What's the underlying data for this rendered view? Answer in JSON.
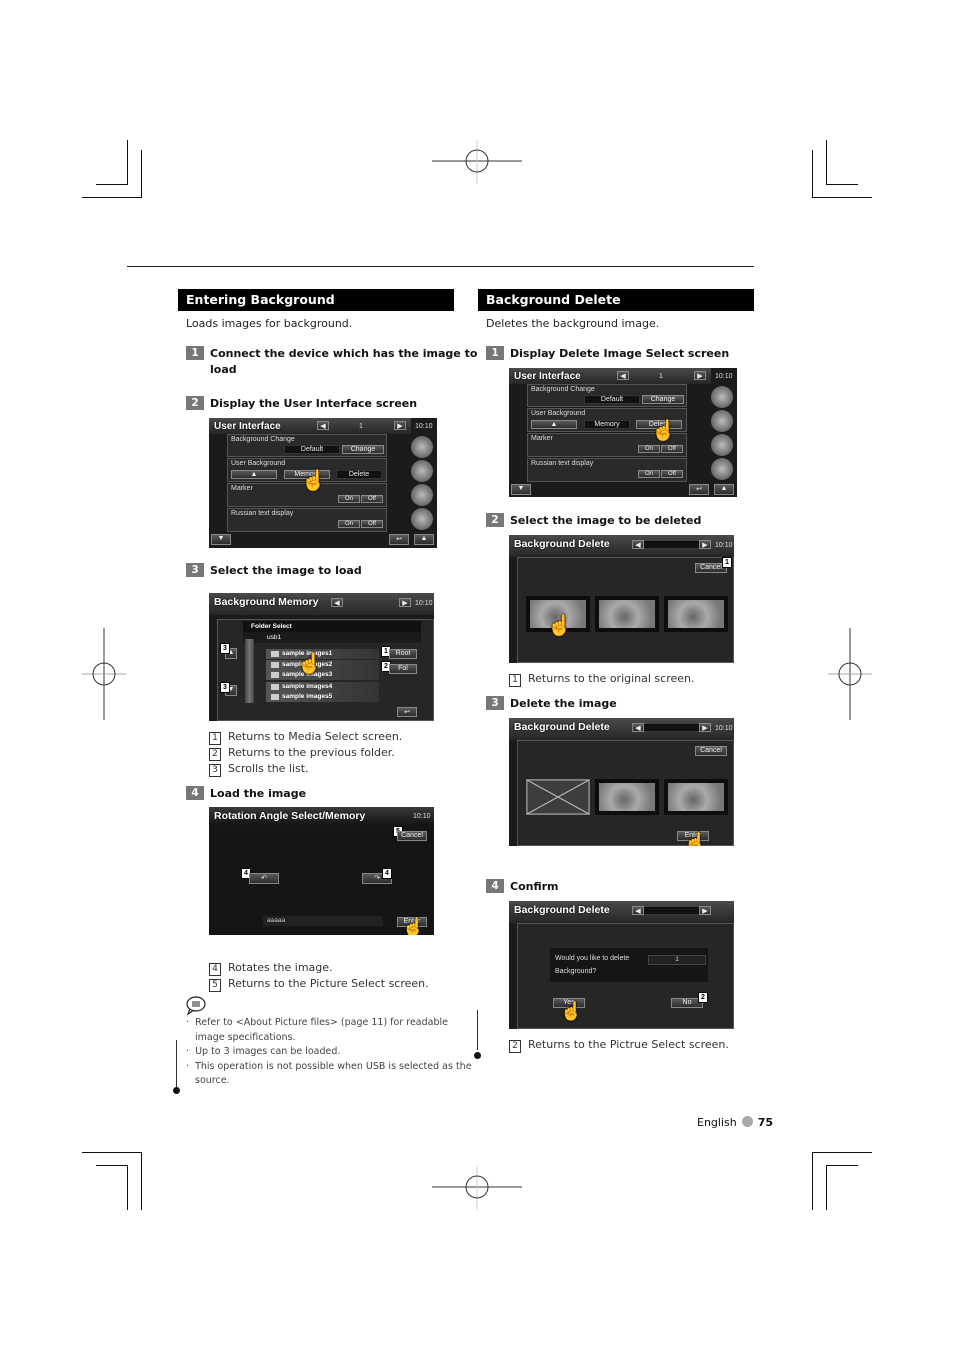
{
  "left": {
    "header": "Entering Background",
    "intro": "Loads images for background.",
    "steps": [
      {
        "num": "1",
        "text": "Connect the device which has the image to",
        "text2": "load"
      },
      {
        "num": "2",
        "text": "Display the User Interface screen"
      },
      {
        "num": "3",
        "text": "Select the image to load"
      },
      {
        "num": "4",
        "text": "Load the image"
      }
    ],
    "ui_screen": {
      "title": "User Interface",
      "page": "1",
      "clock": "10:10",
      "rows": [
        {
          "label": "Background Change",
          "buttons": [
            "Default",
            "Change"
          ]
        },
        {
          "label": "User Background",
          "buttons": [
            "▲",
            "Memory",
            "Delete"
          ]
        },
        {
          "label": "Marker",
          "buttons": [
            "On",
            "Off"
          ]
        },
        {
          "label": "Russian text display",
          "buttons": [
            "On",
            "Off"
          ]
        }
      ]
    },
    "memory_screen": {
      "title": "Background Memory",
      "clock": "10:10",
      "folder_select": "Folder Select",
      "path": "usb1",
      "folders": [
        "sample images1",
        "sample images2",
        "sample images3",
        "sample images4",
        "sample images5"
      ],
      "root": "Root",
      "fol": "Fol",
      "callouts": [
        "1",
        "2",
        "3",
        "3"
      ]
    },
    "memory_notes": [
      {
        "n": "1",
        "text": "Returns to Media Select screen."
      },
      {
        "n": "2",
        "text": "Returns to the previous folder."
      },
      {
        "n": "3",
        "text": "Scrolls the list."
      }
    ],
    "rotation_screen": {
      "title": "Rotation Angle Select/Memory",
      "clock": "10:10",
      "cancel": "Cancel",
      "enter": "Enter",
      "filename": "aaaaa",
      "rotate_left": "↶",
      "rotate_right": "↷",
      "callouts": [
        "5",
        "4",
        "4"
      ]
    },
    "rotation_notes": [
      {
        "n": "4",
        "text": "Rotates the image."
      },
      {
        "n": "5",
        "text": "Returns to the Picture Select screen."
      }
    ],
    "bullets": [
      "Refer to <About Picture files> (page 11) for readable",
      "image specifications.",
      "Up to 3 images can be loaded.",
      "This operation is not possible when USB is selected as the",
      "source."
    ]
  },
  "right": {
    "header": "Background Delete",
    "intro": "Deletes the background image.",
    "steps": [
      {
        "num": "1",
        "text": "Display Delete Image Select screen"
      },
      {
        "num": "2",
        "text": "Select the image to be deleted"
      },
      {
        "num": "3",
        "text": "Delete the image"
      },
      {
        "num": "4",
        "text": "Confirm"
      }
    ],
    "ui_screen": {
      "title": "User Interface",
      "page": "1",
      "clock": "10:10",
      "rows": [
        {
          "label": "Background Change",
          "buttons": [
            "Default",
            "Change"
          ]
        },
        {
          "label": "User Background",
          "buttons": [
            "▲",
            "Memory",
            "Delete"
          ]
        },
        {
          "label": "Marker",
          "buttons": [
            "On",
            "Off"
          ]
        },
        {
          "label": "Russian text display",
          "buttons": [
            "On",
            "Off"
          ]
        }
      ]
    },
    "delete_screen": {
      "title": "Background Delete",
      "clock": "10:10",
      "cancel": "Cancel",
      "enter": "Enter",
      "callout": "1"
    },
    "delete_note": {
      "n": "1",
      "text": "Returns to the original screen."
    },
    "confirm_screen": {
      "title": "Background Delete",
      "question1": "Would you like to delete",
      "question2": "Background?",
      "value": "1",
      "yes": "Yes",
      "no": "No",
      "callout": "2"
    },
    "confirm_note": {
      "n": "2",
      "text": "Returns to the Pictrue Select screen."
    }
  },
  "footer": {
    "language": "English",
    "page": "75"
  }
}
